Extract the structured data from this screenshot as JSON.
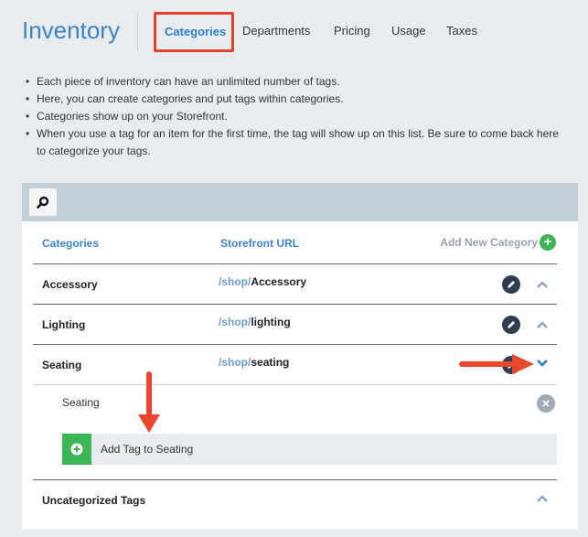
{
  "header": {
    "title": "Inventory",
    "tabs": [
      {
        "label": "Categories",
        "active": true
      },
      {
        "label": "Departments"
      },
      {
        "label": "Pricing"
      },
      {
        "label": "Usage"
      },
      {
        "label": "Taxes"
      }
    ]
  },
  "notes": [
    "Each piece of inventory can have an unlimited number of tags.",
    "Here, you can create categories and put tags within categories.",
    "Categories show up on your Storefront.",
    "When you use a tag for an item for the first time, the tag will show up on this list. Be sure to come back here to categorize your tags."
  ],
  "table": {
    "col_categories": "Categories",
    "col_url": "Storefront URL",
    "add_category": "Add New Category",
    "url_prefix": "/shop/",
    "rows": [
      {
        "name": "Accessory",
        "slug": "Accessory"
      },
      {
        "name": "Lighting",
        "slug": "lighting"
      },
      {
        "name": "Seating",
        "slug": "seating",
        "expanded": true
      }
    ],
    "expanded": {
      "tag": "Seating",
      "add_tag_label": "Add Tag to Seating"
    },
    "uncategorized": "Uncategorized Tags"
  },
  "colors": {
    "accent": "#3d82c4",
    "highlight": "#e2412a",
    "add_green": "#3cb554",
    "arrow": "#e8472e"
  },
  "icons": [
    "search-icon",
    "plus-icon",
    "pencil-icon",
    "chevron-up-icon",
    "chevron-down-icon",
    "close-icon"
  ]
}
